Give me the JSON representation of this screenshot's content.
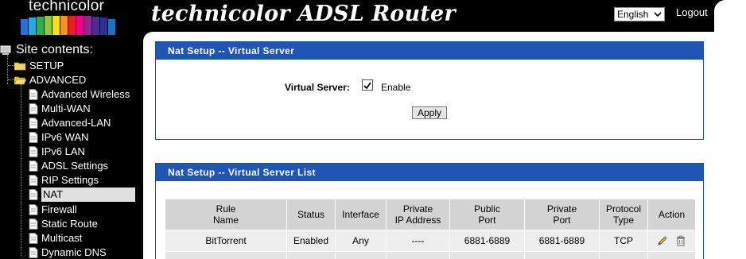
{
  "header": {
    "logo_text": "technicolor",
    "app_title": "technicolor ADSL Router",
    "language": "English",
    "logout_label": "Logout"
  },
  "sidebar": {
    "title": "Site contents:",
    "groups": [
      {
        "label": "SETUP"
      },
      {
        "label": "ADVANCED"
      }
    ],
    "items": [
      {
        "label": "Advanced Wireless"
      },
      {
        "label": "Multi-WAN"
      },
      {
        "label": "Advanced-LAN"
      },
      {
        "label": "IPv6 WAN"
      },
      {
        "label": "IPv6 LAN"
      },
      {
        "label": "ADSL Settings"
      },
      {
        "label": "RIP Settings"
      },
      {
        "label": "NAT"
      },
      {
        "label": "Firewall"
      },
      {
        "label": "Static Route"
      },
      {
        "label": "Multicast"
      },
      {
        "label": "Dynamic DNS"
      }
    ],
    "selected": "NAT"
  },
  "virtual_server": {
    "title": "Nat Setup -- Virtual Server",
    "field_label": "Virtual Server:",
    "enable_label": "Enable",
    "enabled": true,
    "apply_label": "Apply"
  },
  "server_list": {
    "title": "Nat Setup -- Virtual Server List",
    "columns": [
      [
        "Rule",
        "Name"
      ],
      [
        "Status"
      ],
      [
        "Interface"
      ],
      [
        "Private",
        "IP Address"
      ],
      [
        "Public",
        "Port"
      ],
      [
        "Private",
        "Port"
      ],
      [
        "Protocol",
        "Type"
      ],
      [
        "Action"
      ]
    ],
    "rows": [
      {
        "rule_name": "BitTorrent",
        "status": "Enabled",
        "interface": "Any",
        "private_ip": "----",
        "public_port": "6881-6889",
        "private_port": "6881-6889",
        "protocol": "TCP"
      }
    ]
  },
  "colors": {
    "panel_header": "#1f56b3",
    "sidebar_bg": "#000000",
    "table_header": "#d3d3d3"
  }
}
